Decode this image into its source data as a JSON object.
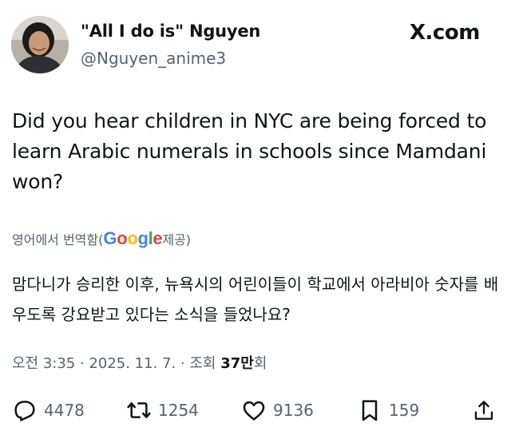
{
  "author": {
    "display_name": "\"All I do is\" Nguyen",
    "handle": "@Nguyen_anime3"
  },
  "brand": "X.com",
  "post": {
    "text": "Did you hear children in NYC are being forced to learn Arabic numerals in schools since Mamdani won?"
  },
  "translation": {
    "prefix": "영어에서 번역함(",
    "provider": "Google",
    "suffix": " 제공)",
    "text": "맘다니가 승리한 이후, 뉴욕시의 어린이들이 학교에서 아라비아 숫자를 배우도록 강요받고 있다는 소식을 들었나요?"
  },
  "meta": {
    "time_date": "오전 3:35 · 2025. 11. 7. · 조회 ",
    "views": "37만",
    "views_suffix": "회"
  },
  "actions": {
    "replies": "4478",
    "reposts": "1254",
    "likes": "9136",
    "bookmarks": "159"
  },
  "icons": {
    "reply": "reply-icon",
    "repost": "repost-icon",
    "like": "heart-icon",
    "bookmark": "bookmark-icon",
    "share": "share-icon"
  }
}
